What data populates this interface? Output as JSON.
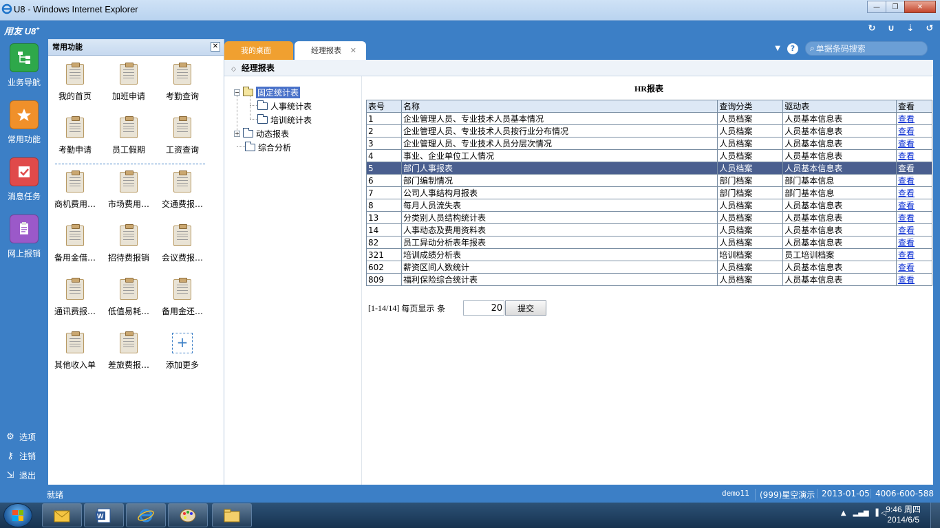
{
  "window": {
    "title": "U8 - Windows Internet Explorer",
    "minimize": "—",
    "restore": "❐",
    "close": "✕"
  },
  "topbar": {
    "logo": "用友 U8",
    "logo_sup": "+",
    "icons": [
      "refresh-icon",
      "u-icon",
      "dropdown-icon",
      "back-icon"
    ]
  },
  "leftnav": {
    "items": [
      {
        "label": "业务导航",
        "icon": "business-nav-icon",
        "color": "#2ea84a"
      },
      {
        "label": "常用功能",
        "icon": "star-icon",
        "color": "#f0902a"
      },
      {
        "label": "消息任务",
        "icon": "message-icon",
        "color": "#e04a4a"
      },
      {
        "label": "网上报销",
        "icon": "expense-icon",
        "color": "#9b59c9"
      }
    ],
    "bottom": [
      {
        "label": "选项",
        "icon": "gear-icon"
      },
      {
        "label": "注销",
        "icon": "key-icon"
      },
      {
        "label": "退出",
        "icon": "exit-icon"
      }
    ]
  },
  "funcpanel": {
    "title": "常用功能",
    "close": "✕",
    "items": [
      "我的首页",
      "加班申请",
      "考勤查询",
      "考勤申请",
      "员工假期",
      "工资查询",
      "商机费用…",
      "市场费用…",
      "交通费报…",
      "备用金借…",
      "招待费报销",
      "会议费报…",
      "通讯费报…",
      "低值易耗…",
      "备用金还…",
      "其他收入单",
      "差旅费报…"
    ],
    "add_more": "添加更多"
  },
  "tabs": [
    {
      "label": "我的桌面",
      "active": false
    },
    {
      "label": "经理报表",
      "active": true,
      "close": "✕"
    }
  ],
  "search": {
    "placeholder": "单据条码搜索"
  },
  "breadcrumb": "经理报表",
  "tree": {
    "root": {
      "label": "固定统计表",
      "toggle": "−",
      "children": [
        "人事统计表",
        "培训统计表"
      ]
    },
    "dynamic": {
      "label": "动态报表",
      "toggle": "+"
    },
    "summary": {
      "label": "综合分析"
    }
  },
  "report": {
    "title": "HR报表",
    "headers": [
      "表号",
      "名称",
      "查询分类",
      "驱动表",
      "查看"
    ],
    "rows": [
      [
        "1",
        "企业管理人员、专业技术人员基本情况",
        "人员档案",
        "人员基本信息表",
        "查看"
      ],
      [
        "2",
        "企业管理人员、专业技术人员按行业分布情况",
        "人员档案",
        "人员基本信息表",
        "查看"
      ],
      [
        "3",
        "企业管理人员、专业技术人员分层次情况",
        "人员档案",
        "人员基本信息表",
        "查看"
      ],
      [
        "4",
        "事业、企业单位工人情况",
        "人员档案",
        "人员基本信息表",
        "查看"
      ],
      [
        "5",
        "部门人事报表",
        "人员档案",
        "人员基本信息表",
        "查看"
      ],
      [
        "6",
        "部门编制情况",
        "部门档案",
        "部门基本信息",
        "查看"
      ],
      [
        "7",
        "公司人事结构月报表",
        "部门档案",
        "部门基本信息",
        "查看"
      ],
      [
        "8",
        "每月人员流失表",
        "人员档案",
        "人员基本信息表",
        "查看"
      ],
      [
        "13",
        "分类别人员结构统计表",
        "人员档案",
        "人员基本信息表",
        "查看"
      ],
      [
        "14",
        "人事动态及费用资料表",
        "人员档案",
        "人员基本信息表",
        "查看"
      ],
      [
        "82",
        "员工异动分析表年报表",
        "人员档案",
        "人员基本信息表",
        "查看"
      ],
      [
        "321",
        "培训成绩分析表",
        "培训档案",
        "员工培训档案",
        "查看"
      ],
      [
        "602",
        "薪资区间人数统计",
        "人员档案",
        "人员基本信息表",
        "查看"
      ],
      [
        "809",
        "福利保险综合统计表",
        "人员档案",
        "人员基本信息表",
        "查看"
      ]
    ],
    "selected_row": 4
  },
  "pager": {
    "range": "[1-14/14]",
    "per_page_label": "每页显示 条",
    "per_page_value": "20",
    "submit": "提交"
  },
  "status": {
    "ready": "就绪",
    "user": "demo11",
    "account": "(999)星空演示",
    "date": "2013-01-05",
    "phone": "4006-600-588"
  },
  "taskbar": {
    "time": "9:46 周四",
    "date": "2014/6/5",
    "tray_up": "▲"
  },
  "colors": {
    "brand_blue": "#3c7fc6",
    "tab_orange": "#f0a030",
    "selected_row": "#4a5f8f",
    "link": "#0b2fd3"
  }
}
